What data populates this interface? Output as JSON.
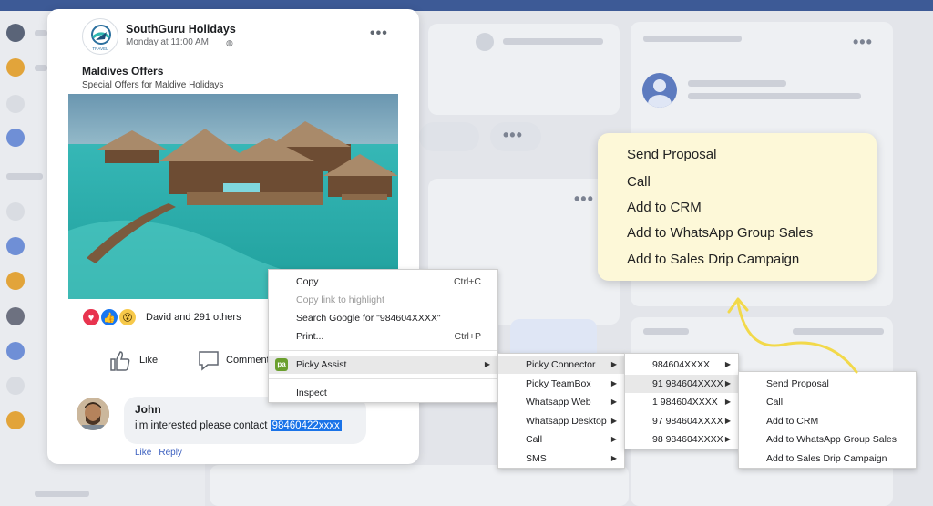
{
  "post": {
    "page_name": "SouthGuru Holidays",
    "time": "Monday at 11:00 AM",
    "title": "Maldives Offers",
    "subtitle": "Special Offers for Maldive Holidays",
    "reactions_text": "David and  291 others",
    "like_label": "Like",
    "comment_label": "Comment",
    "logo_text": "TRAVEL"
  },
  "comment": {
    "author": "John",
    "text_before": "i'm interested please contact ",
    "highlighted": "98460422xxxx",
    "like_link": "Like",
    "reply_link": "Reply"
  },
  "context_menu": {
    "items": [
      {
        "label": "Copy",
        "shortcut": "Ctrl+C"
      },
      {
        "label": "Copy link to highlight"
      },
      {
        "label": "Search Google for \"984604XXXX\""
      },
      {
        "label": "Print...",
        "shortcut": "Ctrl+P"
      },
      {
        "label": "Picky Assist"
      },
      {
        "label": "Inspect"
      }
    ]
  },
  "submenu_apps": {
    "items": [
      "Picky Connector",
      "Picky TeamBox",
      "Whatsapp Web",
      "Whatsapp Desktop",
      "Call",
      "SMS"
    ]
  },
  "submenu_numbers": {
    "items": [
      "984604XXXX",
      "91 984604XXXX",
      "1 984604XXXX",
      "97 984604XXXX",
      "98 984604XXXX"
    ]
  },
  "submenu_actions": {
    "items": [
      "Send Proposal",
      "Call",
      "Add to CRM",
      "Add to WhatsApp Group Sales",
      "Add to Sales Drip Campaign"
    ]
  },
  "callout": {
    "items": [
      "Send Proposal",
      "Call",
      "Add to CRM",
      "Add to WhatsApp Group Sales",
      "Add to Sales Drip Campaign"
    ]
  },
  "colors": {
    "topbar": "#3d5a96",
    "callout_bg": "#fdf8d8",
    "arrow": "#f2d94a",
    "highlight": "#1a73e8"
  }
}
